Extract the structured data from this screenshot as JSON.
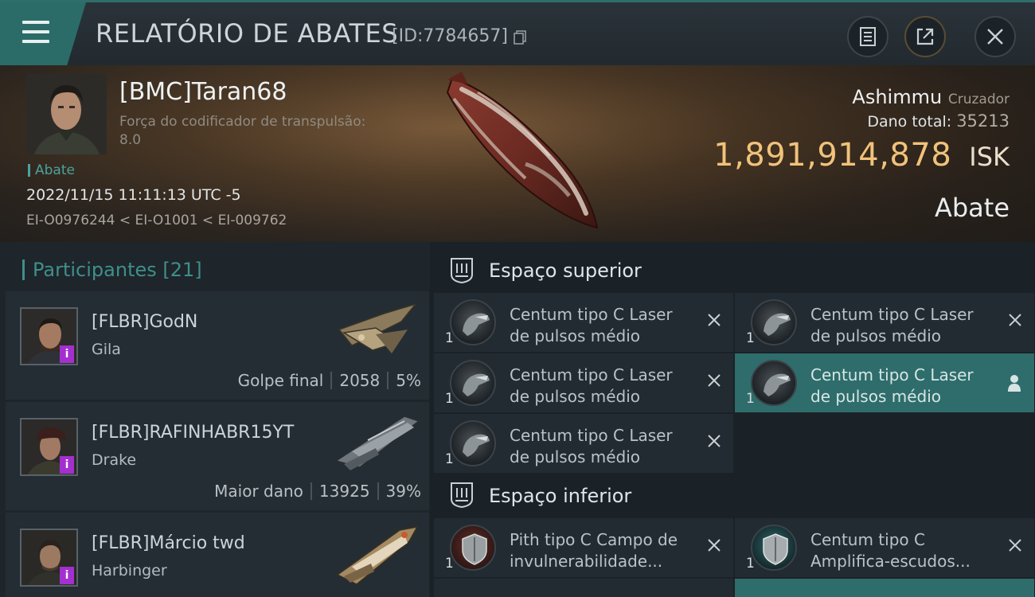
{
  "header": {
    "title": "RELATÓRIO DE ABATES",
    "report_id": "[ID:7784657]"
  },
  "victim": {
    "name": "[BMC]Taran68",
    "subtitle": "Força do codificador de transpulsão: 8.0",
    "tag": "Abate",
    "datetime": "2022/11/15 11:11:13 UTC -5",
    "location": "EI-O0976244 < EI-O1001 < EI-009762",
    "ship": "Ashimmu",
    "ship_class": "Cruzador",
    "damage_label": "Dano total:",
    "damage_value": "35213",
    "isk_value": "1,891,914,878",
    "isk_unit": "ISK",
    "kill_type": "Abate"
  },
  "participants": {
    "label": "Participantes",
    "count": "[21]",
    "items": [
      {
        "name": "[FLBR]GodN",
        "ship": "Gila",
        "role": "Golpe final",
        "damage": "2058",
        "percent": "5%"
      },
      {
        "name": "[FLBR]RAFINHABR15YT",
        "ship": "Drake",
        "role": "Maior dano",
        "damage": "13925",
        "percent": "39%"
      },
      {
        "name": "[FLBR]Márcio twd",
        "ship": "Harbinger"
      }
    ]
  },
  "modules": {
    "high_slots_title": "Espaço superior",
    "low_slots_title": "Espaço inferior",
    "high": [
      {
        "qty": "1",
        "name": "Centum tipo C Laser\nde pulsos médio",
        "state": "destroyed"
      },
      {
        "qty": "1",
        "name": "Centum tipo C Laser\nde pulsos médio",
        "state": "destroyed"
      },
      {
        "qty": "1",
        "name": "Centum tipo C Laser\nde pulsos médio",
        "state": "destroyed"
      },
      {
        "qty": "1",
        "name": "Centum tipo C Laser\nde pulsos médio",
        "state": "dropped"
      },
      {
        "qty": "1",
        "name": "Centum tipo C Laser\nde pulsos médio",
        "state": "destroyed"
      }
    ],
    "low": [
      {
        "qty": "1",
        "name": "Pith tipo C Campo de\ninvulnerabilidade...",
        "state": "destroyed"
      },
      {
        "qty": "1",
        "name": "Centum tipo C\nAmplifica-escudos...",
        "state": "destroyed"
      }
    ]
  },
  "colors": {
    "accent": "#2e6d6b",
    "isk": "#f1c27a",
    "badge": "#a42fd0"
  }
}
